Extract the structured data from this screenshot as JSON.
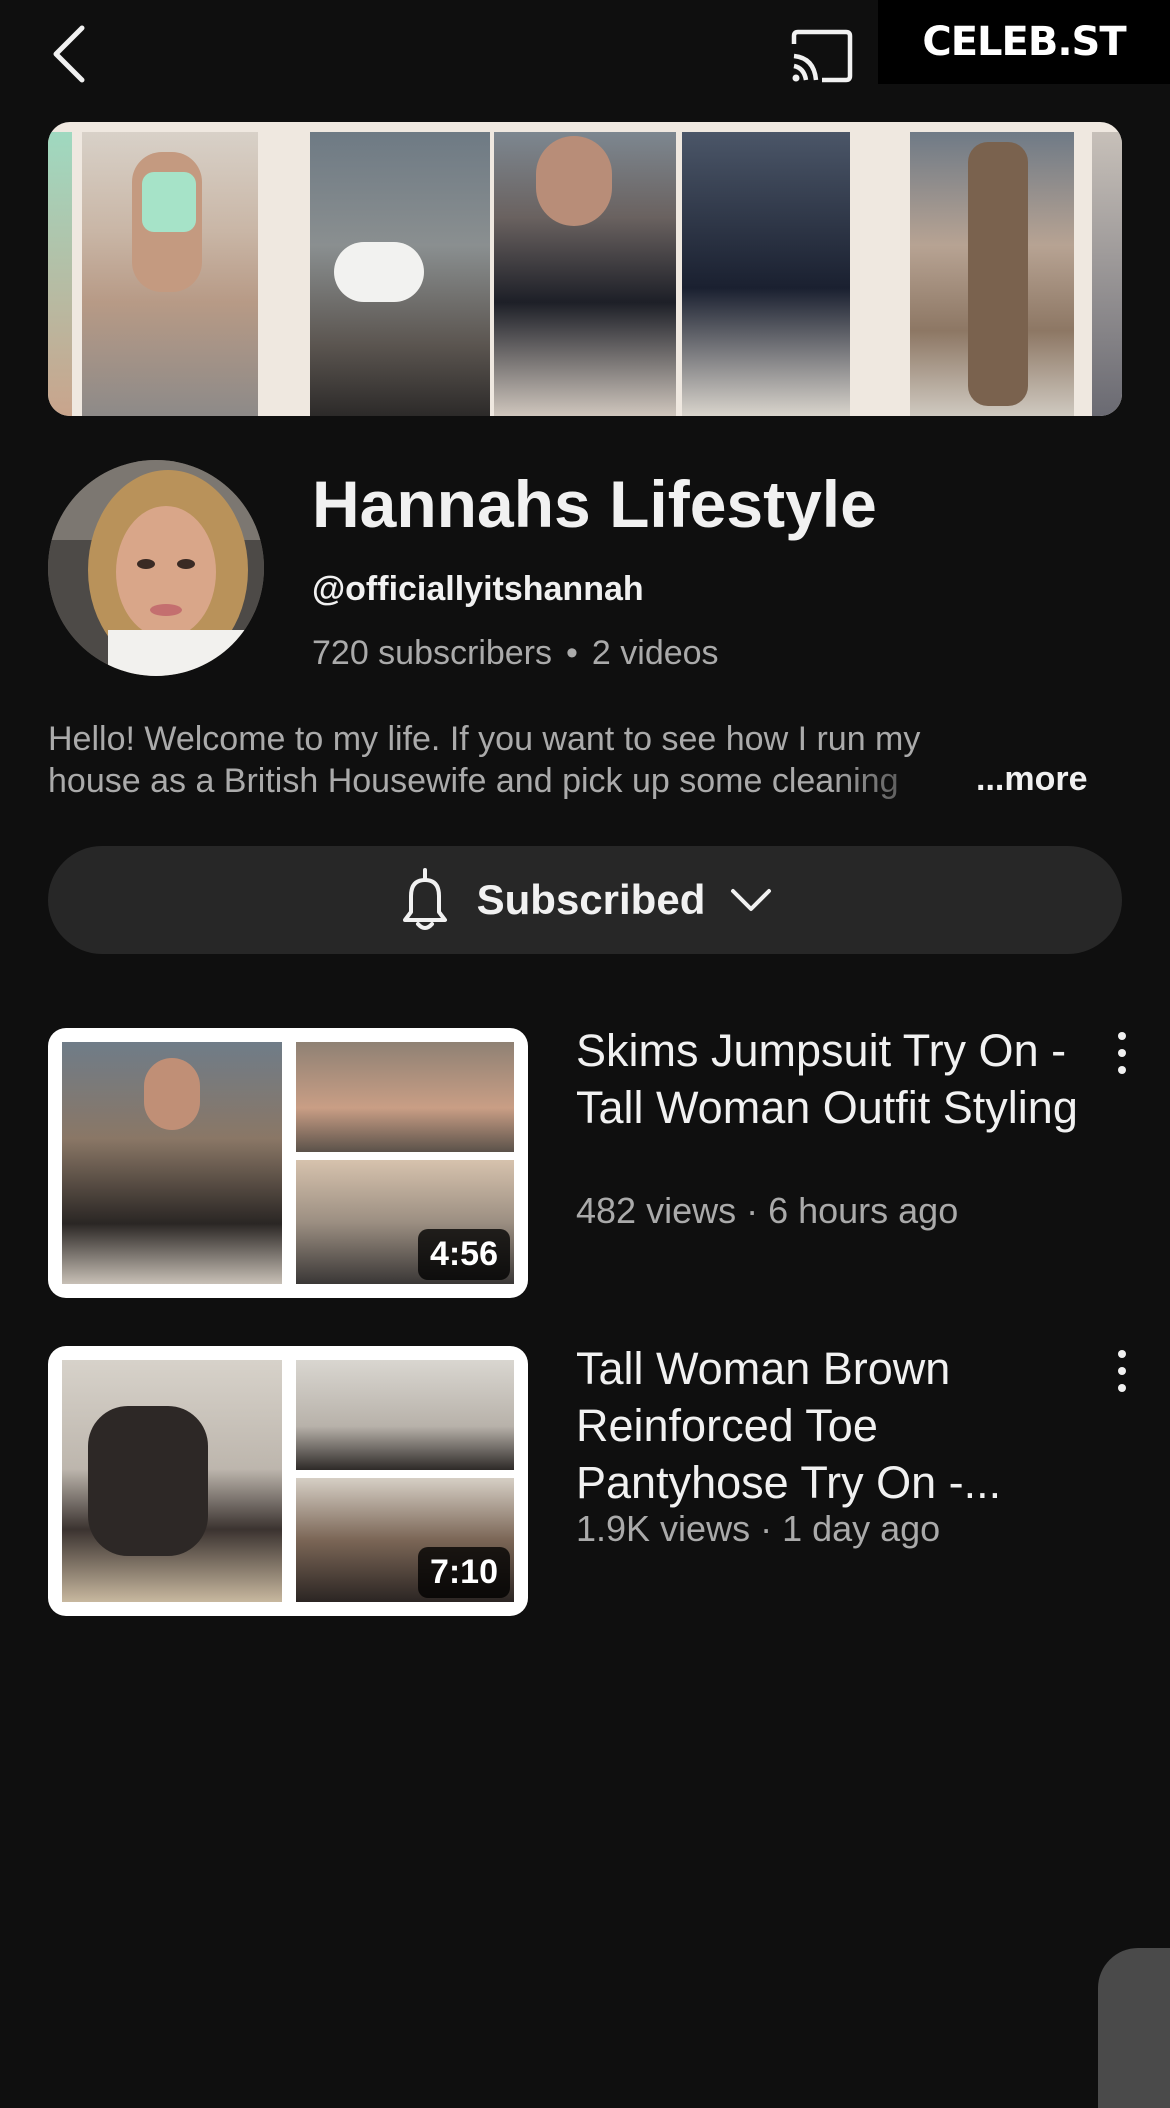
{
  "header": {
    "watermark": "CELEB.ST"
  },
  "channel": {
    "name": "Hannahs Lifestyle",
    "handle": "@officiallyitshannah",
    "subscribers": "720 subscribers",
    "stats_separator": "•",
    "videos": "2 videos",
    "description_line1": "Hello! Welcome to my life. If you want to see how I run my",
    "description_line2": "house as a British Housewife and pick up some cleaning",
    "more_label": "...more"
  },
  "subscribe": {
    "label": "Subscribed"
  },
  "videos": [
    {
      "title": "Skims Jumpsuit Try On - Tall Woman Outfit Styling",
      "meta": "482 views · 6 hours ago",
      "duration": "4:56"
    },
    {
      "title": "Tall Woman Brown Reinforced Toe Pantyhose Try On -...",
      "meta": "1.9K views · 1 day ago",
      "duration": "7:10"
    }
  ],
  "icons": {
    "back": "chevron-left-icon",
    "cast": "cast-icon",
    "bell": "bell-icon",
    "dropdown": "chevron-down-icon",
    "more": "more-vertical-icon"
  },
  "colors": {
    "background": "#0f0f0f",
    "surface": "#272727",
    "text_primary": "#f1f1f1",
    "text_secondary": "#aaaaaa"
  }
}
